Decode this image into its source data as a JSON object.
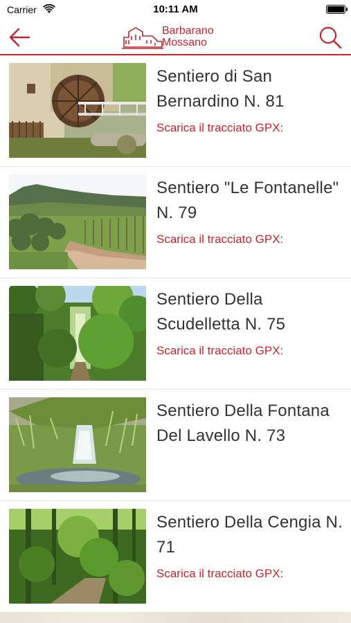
{
  "status_bar": {
    "carrier": "Carrier",
    "time": "10:11 AM"
  },
  "header": {
    "logo_line1": "Barbarano",
    "logo_line2": "Mossano",
    "accent_color": "#c8232c",
    "back_icon": "arrow-left-icon",
    "search_icon": "search-icon"
  },
  "trails": [
    {
      "title": "Sentiero di San Bernardino N. 81",
      "link": "Scarica il tracciato GPX:",
      "image": "water-mill"
    },
    {
      "title": "Sentiero \"Le Fontanelle\" N. 79",
      "link": "Scarica il tracciato GPX:",
      "image": "vineyard-road"
    },
    {
      "title": "Sentiero Della Scudelletta N. 75",
      "link": "Scarica il tracciato GPX:",
      "image": "forest-path"
    },
    {
      "title": "Sentiero Della Fontana Del Lavello N. 73",
      "link": "",
      "image": "stream-spring"
    },
    {
      "title": "Sentiero Della Cengia N. 71",
      "link": "Scarica il tracciato GPX:",
      "image": "woodland-trail"
    }
  ]
}
